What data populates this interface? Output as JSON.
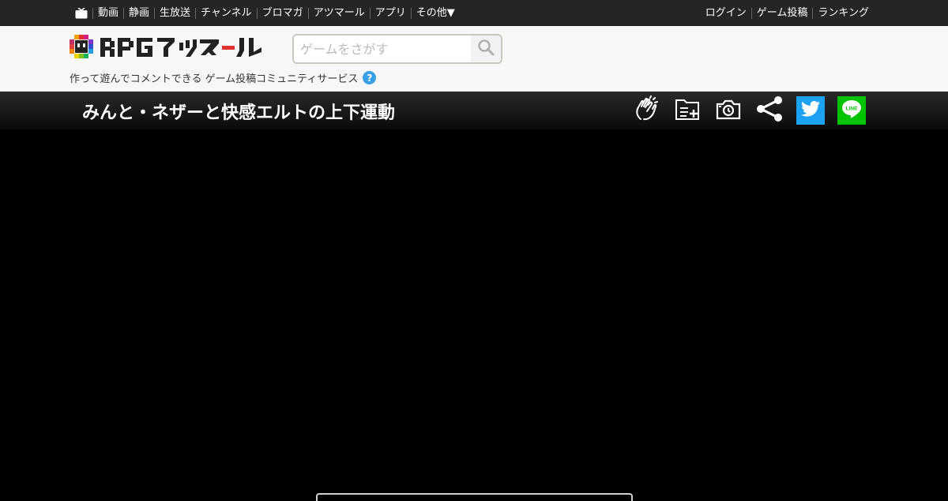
{
  "nav": {
    "items": [
      "動画",
      "静画",
      "生放送",
      "チャンネル",
      "ブロマガ",
      "アツマール",
      "アプリ",
      "その他▼"
    ],
    "right_items": [
      "ログイン",
      "ゲーム投稿",
      "ランキング"
    ]
  },
  "header": {
    "logo_text": "RPGアツマール",
    "search": {
      "placeholder": "ゲームをさがす",
      "value": ""
    },
    "tagline": "作って遊んでコメントできる ゲーム投稿コミュニティサービス",
    "help_symbol": "?"
  },
  "game": {
    "title": "みんと・ネザーと快感エルトの上下運動"
  },
  "colors": {
    "topbar_bg": "#252525",
    "header_bg": "#f7f7f7",
    "twitter": "#1da1f2",
    "line": "#00c300",
    "help": "#3aa0e6"
  },
  "icons": [
    "tv-icon",
    "search-icon",
    "help-icon",
    "clap-icon",
    "playlist-add-icon",
    "camera-icon",
    "share-icon",
    "twitter-icon",
    "line-icon"
  ],
  "share": {
    "line_label": "LINE"
  }
}
